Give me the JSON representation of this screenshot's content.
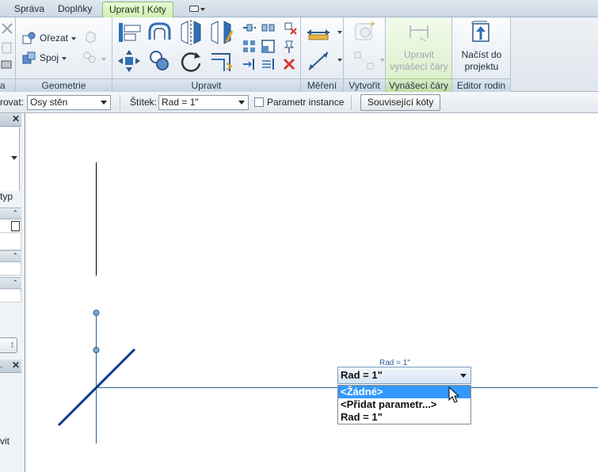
{
  "tabs": [
    "Správa",
    "Doplňky",
    "Upravit | Kóty"
  ],
  "ribbon": {
    "panels": {
      "partial_left": "a",
      "geometry": "Geometrie",
      "modify": "Upravit",
      "measure": "Měření",
      "create": "Vytvořit",
      "witness": "Vynášecí čáry",
      "family_editor": "Editor rodin"
    },
    "geometry": {
      "cut": "Ořezat",
      "join": "Spoj"
    },
    "witness_button": [
      "Upravit",
      "vynášecí čáry"
    ],
    "load_button": [
      "Načíst do",
      "projektu"
    ]
  },
  "options_bar": {
    "reference_label": "rovat:",
    "reference_value": "Osy stěn",
    "label_label": "Štítek:",
    "label_value": "Rad = 1\"",
    "instance_param": "Parametr instance",
    "related_dims": "Související kóty"
  },
  "left_palette": {
    "type_text": "typ",
    "button_text": "t",
    "bottom_text": "vit"
  },
  "canvas": {
    "dimension_text": "Rad = 1\"",
    "dropdown": {
      "value": "Rad = 1\"",
      "options": [
        "<Žádné>",
        "<Přidat parametr...>",
        "Rad = 1\""
      ],
      "selected_index": 0
    }
  },
  "colors": {
    "accent_green": "#cdeeb2",
    "selection_blue": "#3399ff",
    "line_blue": "#0b3a8c",
    "ref_line": "#2a5f8f"
  }
}
